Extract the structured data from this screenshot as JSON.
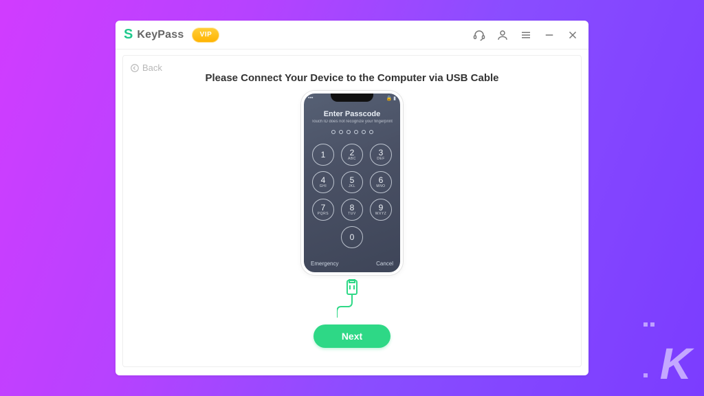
{
  "header": {
    "app_name": "KeyPass",
    "vip_label": "VIP"
  },
  "panel": {
    "back_label": "Back",
    "headline": "Please Connect Your Device to the Computer via USB Cable",
    "next_label": "Next"
  },
  "phone": {
    "status_left": "▪▪▪",
    "status_right": "🔒 ▮",
    "title": "Enter Passcode",
    "subtitle": "Touch ID does not recognize your fingerprint",
    "emergency": "Emergency",
    "cancel": "Cancel",
    "keys": {
      "k1": "1",
      "k2": "2",
      "k3": "3",
      "k4": "4",
      "k5": "5",
      "k6": "6",
      "k7": "7",
      "k8": "8",
      "k9": "9",
      "k0": "0",
      "s2": "ABC",
      "s3": "DEF",
      "s4": "GHI",
      "s5": "JKL",
      "s6": "MNO",
      "s7": "PQRS",
      "s8": "TUV",
      "s9": "WXYZ"
    }
  },
  "watermark": "K"
}
